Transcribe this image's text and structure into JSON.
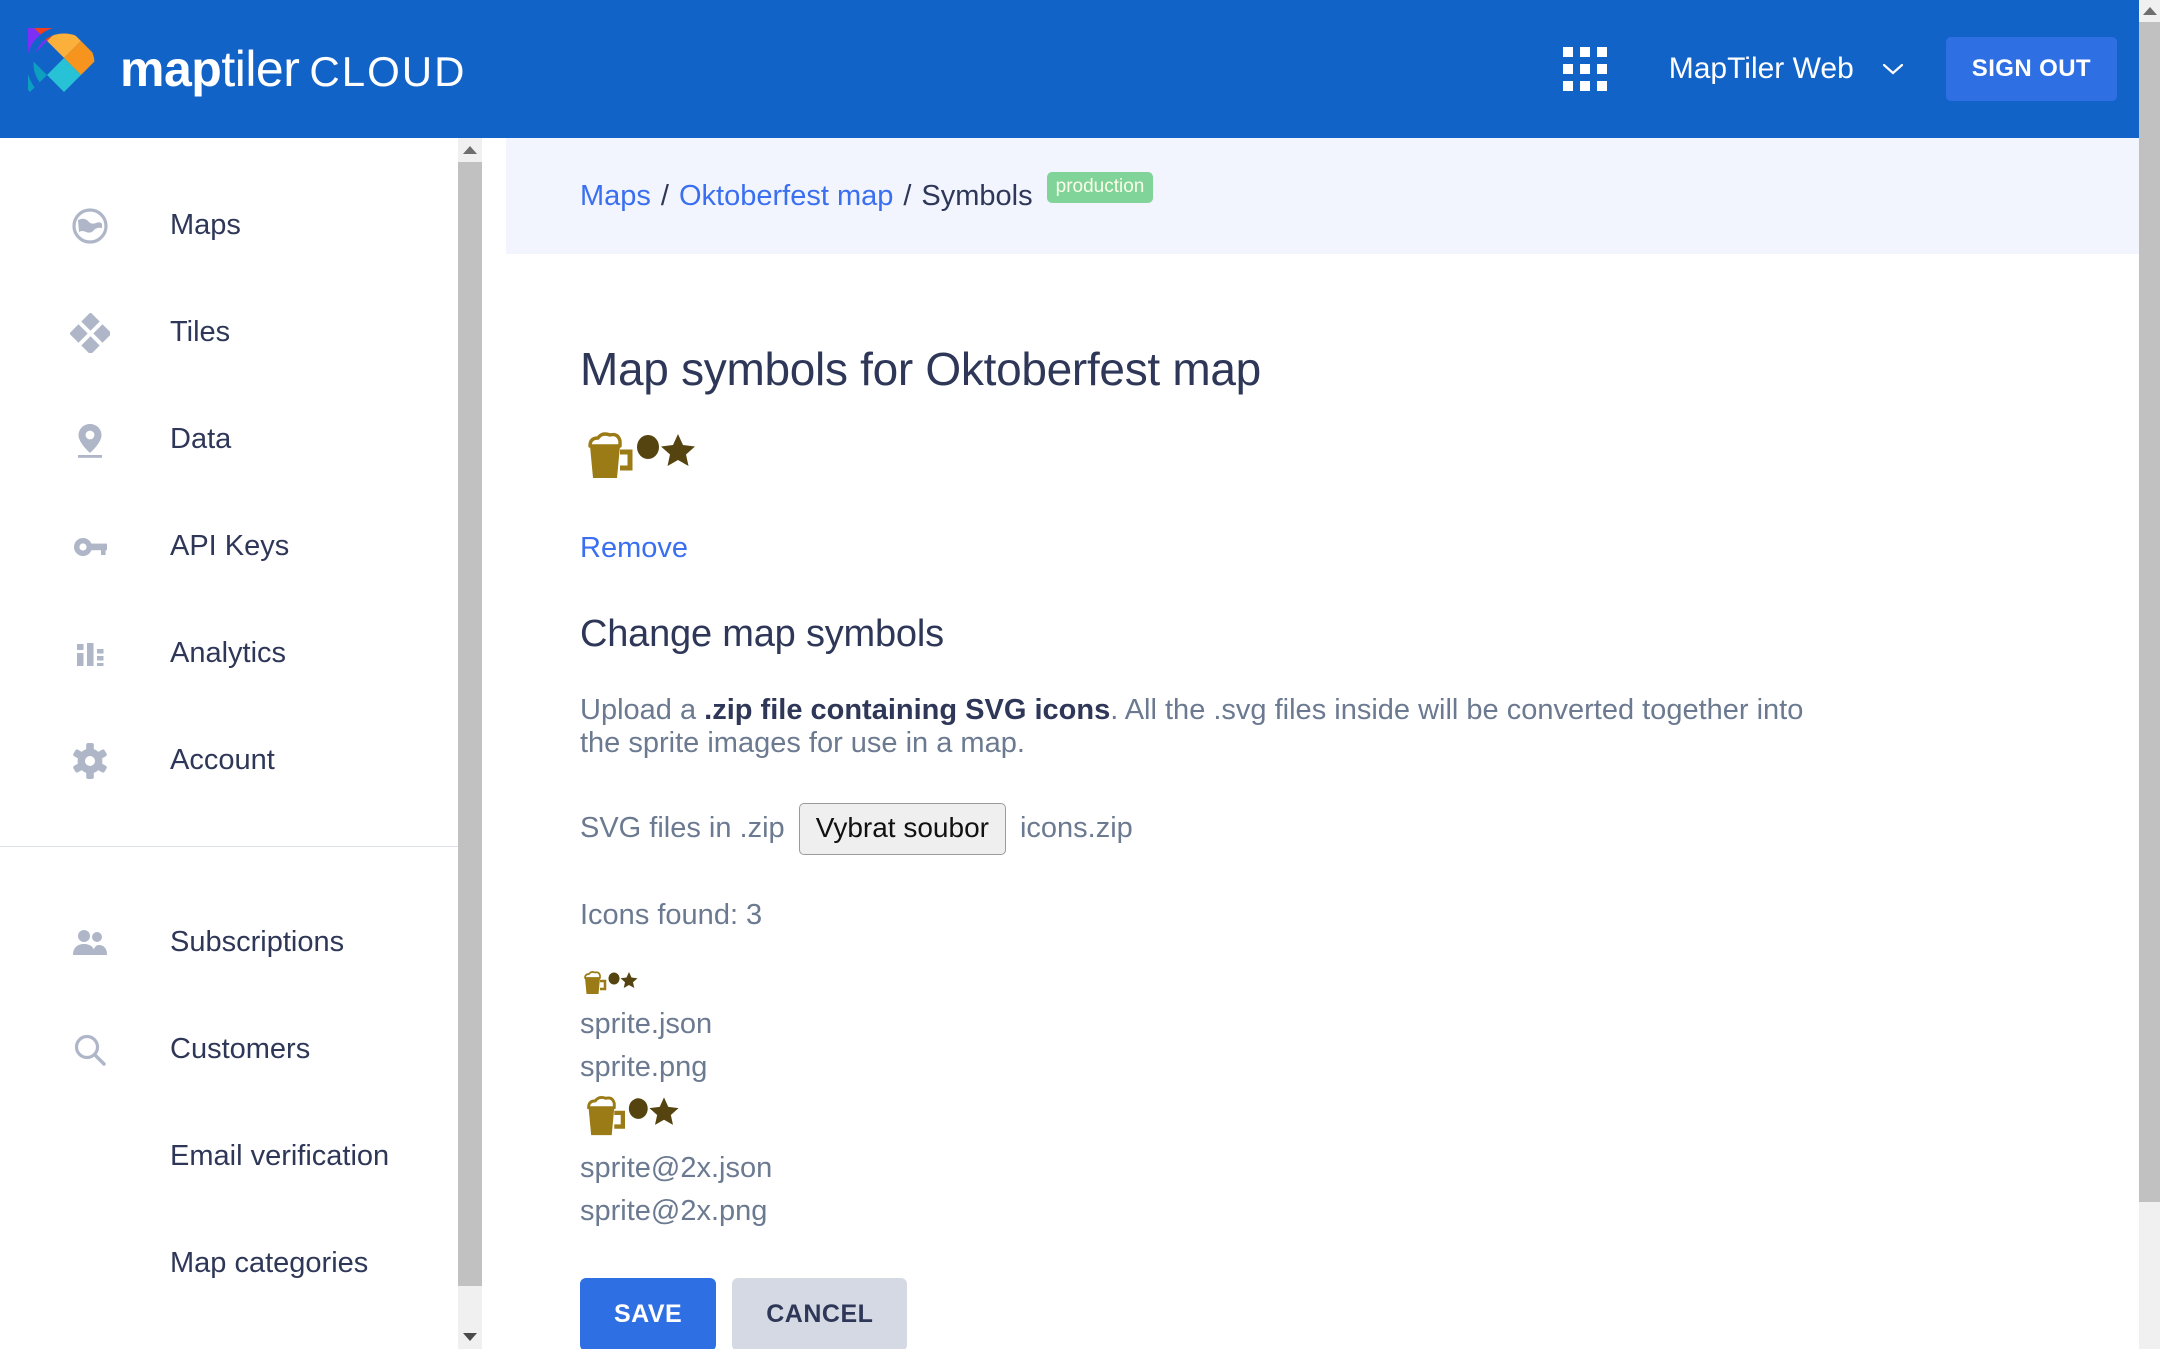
{
  "header": {
    "logo_bold": "map",
    "logo_light": "tiler",
    "logo_cloud": "CLOUD",
    "apps_icon": "apps-grid-icon",
    "account_name": "MapTiler Web",
    "chevron_icon": "chevron-down-icon",
    "signout_label": "SIGN OUT",
    "brand_color": "#1263c8",
    "accent_color": "#2f6fe4"
  },
  "sidebar": {
    "items": [
      {
        "label": "Maps",
        "icon": "globe-icon"
      },
      {
        "label": "Tiles",
        "icon": "diamonds-icon"
      },
      {
        "label": "Data",
        "icon": "map-pin-icon"
      },
      {
        "label": "API Keys",
        "icon": "key-icon"
      },
      {
        "label": "Analytics",
        "icon": "bar-chart-icon"
      },
      {
        "label": "Account",
        "icon": "gear-icon"
      }
    ],
    "items_secondary": [
      {
        "label": "Subscriptions",
        "icon": "people-icon"
      },
      {
        "label": "Customers",
        "icon": "search-icon"
      },
      {
        "label": "Email verification",
        "icon": ""
      },
      {
        "label": "Map categories",
        "icon": ""
      }
    ]
  },
  "breadcrumb": {
    "maps": "Maps",
    "map_name": "Oktoberfest map",
    "current": "Symbols",
    "separator": "/",
    "badge": "production",
    "badge_color": "#80d49a"
  },
  "main": {
    "page_title": "Map symbols for Oktoberfest map",
    "remove_label": "Remove",
    "section_title": "Change map symbols",
    "help_prefix": "Upload a ",
    "help_bold": ".zip file containing SVG icons",
    "help_suffix": ". All the .svg files inside will be converted together into the sprite images for use in a map.",
    "file_label": "SVG files in .zip",
    "file_button_label": "Vybrat soubor",
    "file_name": "icons.zip",
    "icons_found": "Icons found: 3",
    "sprite_files_1x": [
      "sprite.json",
      "sprite.png"
    ],
    "sprite_files_2x": [
      "sprite@2x.json",
      "sprite@2x.png"
    ],
    "save_label": "SAVE",
    "cancel_label": "CANCEL",
    "sprite_icons": [
      "beer-mug-icon",
      "circle-icon",
      "star-icon"
    ],
    "sprite_color_mug": "#9a7b16",
    "sprite_color_dark": "#55440f"
  }
}
